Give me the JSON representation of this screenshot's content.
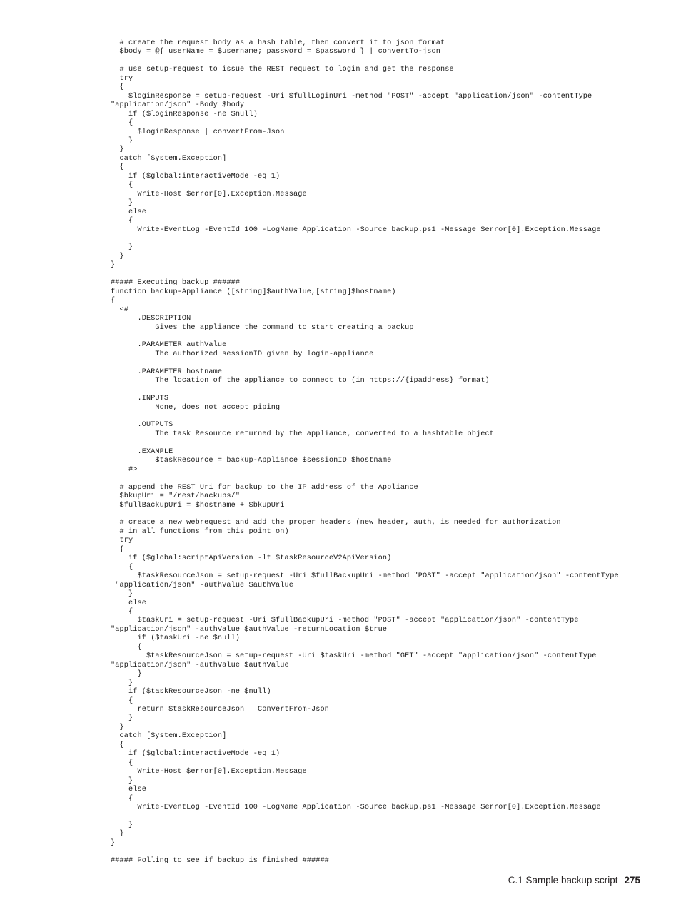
{
  "document": {
    "page_number": "275",
    "footer_title": "C.1 Sample backup script"
  },
  "code": {
    "language": "powershell",
    "lines": [
      "  # create the request body as a hash table, then convert it to json format",
      "  $body = @{ userName = $username; password = $password } | convertTo-json",
      "",
      "  # use setup-request to issue the REST request to login and get the response",
      "  try",
      "  {",
      "    $loginResponse = setup-request -Uri $fullLoginUri -method \"POST\" -accept \"application/json\" -contentType",
      "\"application/json\" -Body $body",
      "    if ($loginResponse -ne $null)",
      "    {",
      "      $loginResponse | convertFrom-Json",
      "    }",
      "  }",
      "  catch [System.Exception]",
      "  {",
      "    if ($global:interactiveMode -eq 1)",
      "    {",
      "      Write-Host $error[0].Exception.Message",
      "    }",
      "    else",
      "    {",
      "      Write-EventLog -EventId 100 -LogName Application -Source backup.ps1 -Message $error[0].Exception.Message",
      "",
      "    }",
      "  }",
      "}",
      "",
      "##### Executing backup ######",
      "function backup-Appliance ([string]$authValue,[string]$hostname)",
      "{",
      "  <#",
      "      .DESCRIPTION",
      "          Gives the appliance the command to start creating a backup",
      "",
      "      .PARAMETER authValue",
      "          The authorized sessionID given by login-appliance",
      "",
      "      .PARAMETER hostname",
      "          The location of the appliance to connect to (in https://{ipaddress} format)",
      "",
      "      .INPUTS",
      "          None, does not accept piping",
      "",
      "      .OUTPUTS",
      "          The task Resource returned by the appliance, converted to a hashtable object",
      "",
      "      .EXAMPLE",
      "          $taskResource = backup-Appliance $sessionID $hostname",
      "    #>",
      "",
      "  # append the REST Uri for backup to the IP address of the Appliance",
      "  $bkupUri = \"/rest/backups/\"",
      "  $fullBackupUri = $hostname + $bkupUri",
      "",
      "  # create a new webrequest and add the proper headers (new header, auth, is needed for authorization",
      "  # in all functions from this point on)",
      "  try",
      "  {",
      "    if ($global:scriptApiVersion -lt $taskResourceV2ApiVersion)",
      "    {",
      "      $taskResourceJson = setup-request -Uri $fullBackupUri -method \"POST\" -accept \"application/json\" -contentType",
      " \"application/json\" -authValue $authValue",
      "    }",
      "    else",
      "    {",
      "      $taskUri = setup-request -Uri $fullBackupUri -method \"POST\" -accept \"application/json\" -contentType",
      "\"application/json\" -authValue $authValue -returnLocation $true",
      "      if ($taskUri -ne $null)",
      "      {",
      "        $taskResourceJson = setup-request -Uri $taskUri -method \"GET\" -accept \"application/json\" -contentType",
      "\"application/json\" -authValue $authValue",
      "      }",
      "    }",
      "    if ($taskResourceJson -ne $null)",
      "    {",
      "      return $taskResourceJson | ConvertFrom-Json",
      "    }",
      "  }",
      "  catch [System.Exception]",
      "  {",
      "    if ($global:interactiveMode -eq 1)",
      "    {",
      "      Write-Host $error[0].Exception.Message",
      "    }",
      "    else",
      "    {",
      "      Write-EventLog -EventId 100 -LogName Application -Source backup.ps1 -Message $error[0].Exception.Message",
      "",
      "    }",
      "  }",
      "}",
      "",
      "##### Polling to see if backup is finished ######"
    ]
  }
}
